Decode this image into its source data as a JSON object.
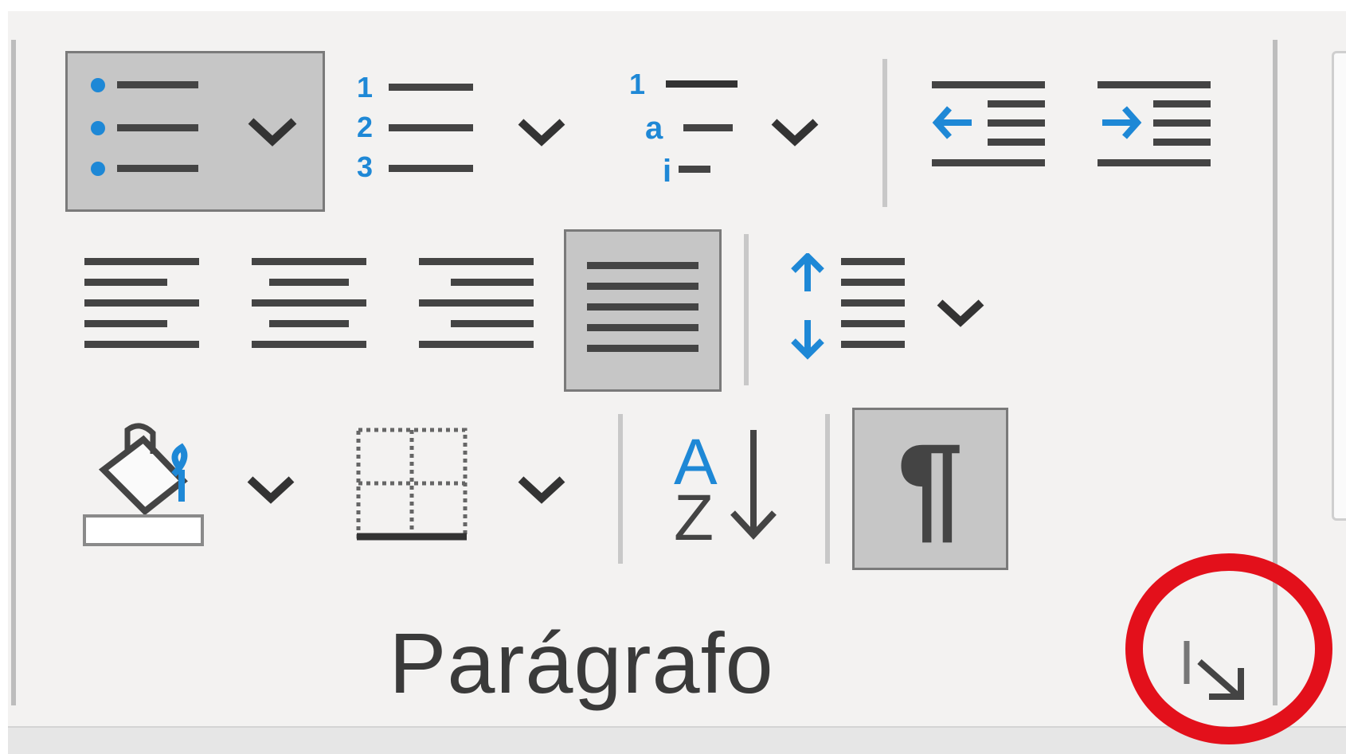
{
  "group": {
    "label": "Parágrafo"
  },
  "accent": "#1e88d6",
  "highlight": "#e3101b",
  "buttons": {
    "bullets": {
      "icon": "bullets-icon",
      "pressed": true
    },
    "numbering": {
      "icon": "numbering-icon"
    },
    "multilevel": {
      "icon": "multilevel-list-icon"
    },
    "decrease_indent": {
      "icon": "decrease-indent-icon"
    },
    "increase_indent": {
      "icon": "increase-indent-icon"
    },
    "align_left": {
      "icon": "align-left-icon"
    },
    "align_center": {
      "icon": "align-center-icon"
    },
    "align_right": {
      "icon": "align-right-icon"
    },
    "justify": {
      "icon": "justify-icon",
      "pressed": true
    },
    "line_spacing": {
      "icon": "line-spacing-icon"
    },
    "shading": {
      "icon": "paint-bucket-icon"
    },
    "borders": {
      "icon": "borders-icon"
    },
    "sort": {
      "icon": "sort-az-icon",
      "glyph_a": "A",
      "glyph_z": "Z"
    },
    "show_marks": {
      "icon": "pilcrow-icon",
      "glyph": "¶",
      "pressed": true
    },
    "dialog_launcher": {
      "icon": "dialog-launcher-icon"
    }
  }
}
